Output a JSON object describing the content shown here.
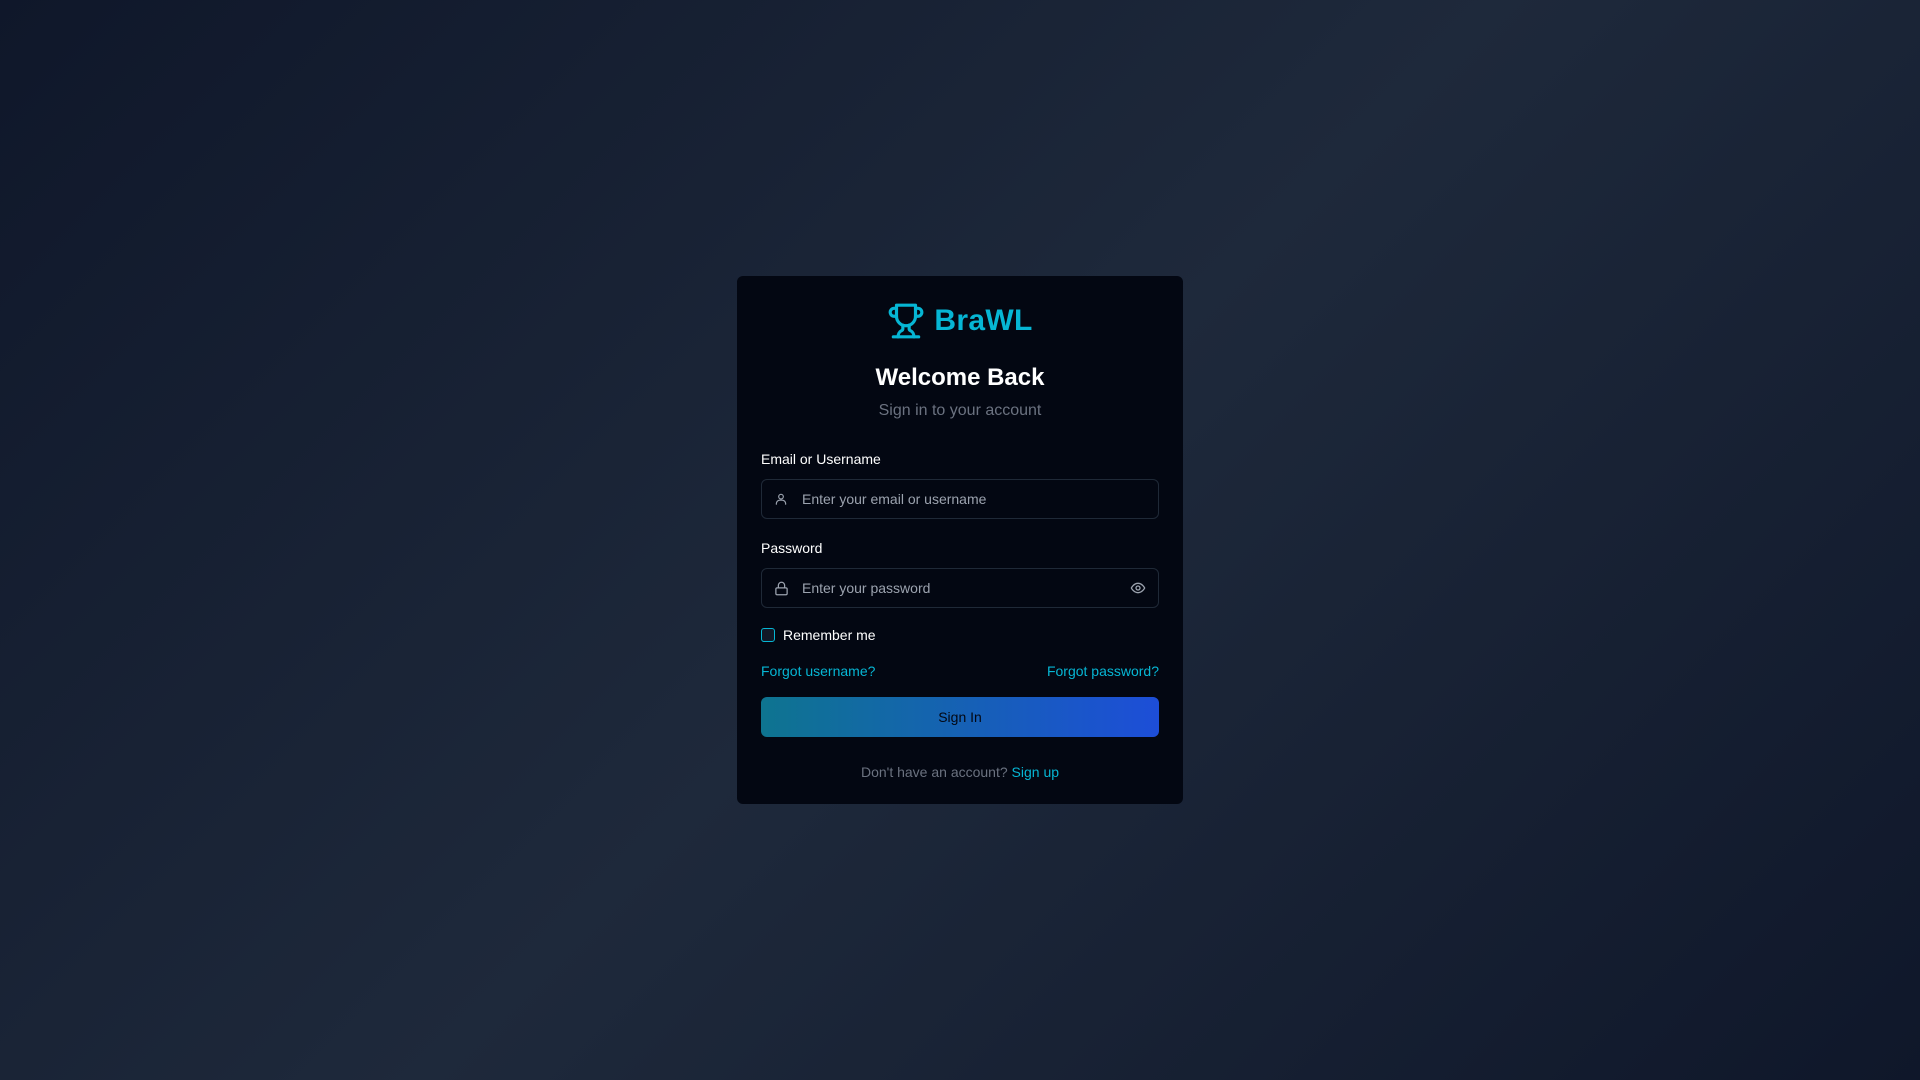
{
  "brand": {
    "name": "BraWL",
    "icon": "trophy-icon",
    "accent_color": "#06b6d4"
  },
  "header": {
    "title": "Welcome Back",
    "subtitle": "Sign in to your account"
  },
  "form": {
    "email": {
      "label": "Email or Username",
      "placeholder": "Enter your email or username",
      "value": "",
      "icon": "user-icon"
    },
    "password": {
      "label": "Password",
      "placeholder": "Enter your password",
      "value": "",
      "icon": "lock-icon",
      "toggle_icon": "eye-icon"
    },
    "remember": {
      "label": "Remember me",
      "checked": false
    },
    "forgot_username": "Forgot username?",
    "forgot_password": "Forgot password?",
    "submit_label": "Sign In"
  },
  "footer": {
    "prompt": "Don't have an account?",
    "signup_label": "Sign up"
  },
  "colors": {
    "background": "#0f172a",
    "card": "#030712",
    "button_start": "#0e7490",
    "button_end": "#1d4ed8"
  }
}
